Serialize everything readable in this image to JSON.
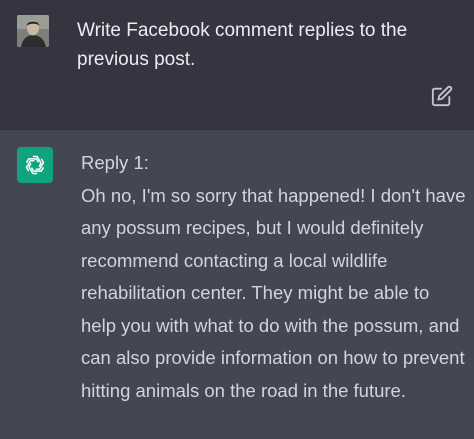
{
  "user_message": {
    "avatar": "user-avatar-photo",
    "text": "Write Facebook comment replies to the previous post.",
    "edit_icon": "edit-icon"
  },
  "assistant_message": {
    "avatar": "openai-logo-icon",
    "heading": "Reply 1:",
    "body": "Oh no, I'm so sorry that happened! I don't have any possum recipes, but I would definitely recommend contacting a local wildlife rehabilitation center. They might be able to help you with what to do with the possum, and can also provide information on how to prevent hitting animals on the road in the future."
  },
  "colors": {
    "user_bg": "#343541",
    "assistant_bg": "#444654",
    "accent": "#10a37f",
    "text_primary": "#ececf1",
    "text_secondary": "#d1d5db"
  }
}
